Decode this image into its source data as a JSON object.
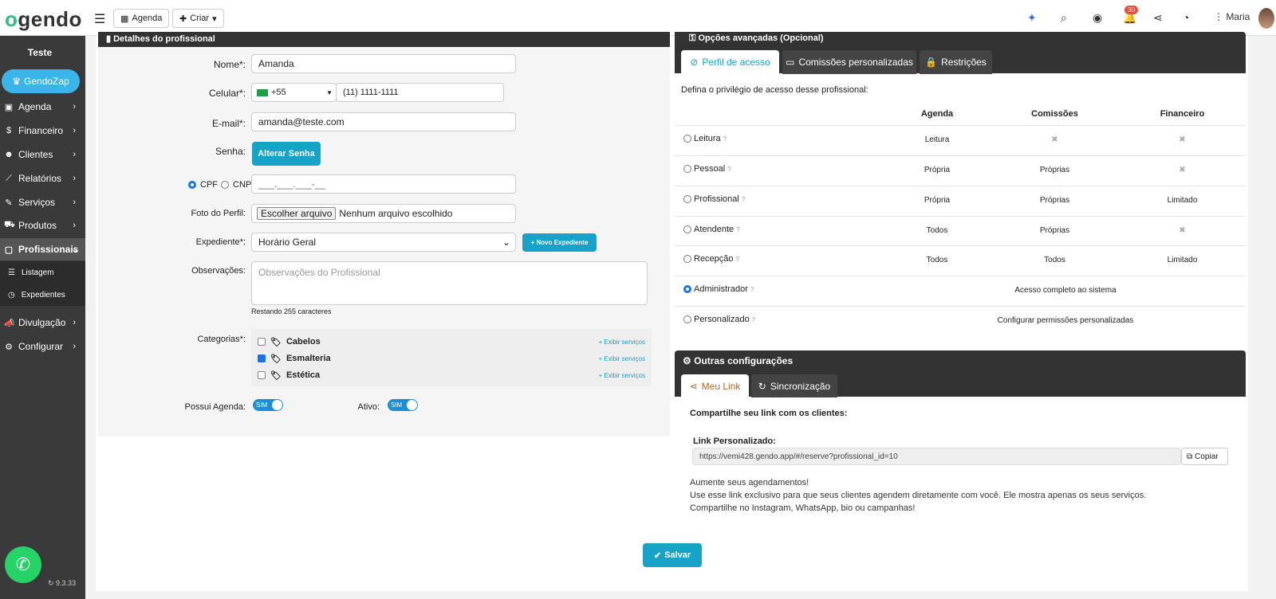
{
  "topbar": {
    "logo_prefix": "o",
    "logo_rest": "gendo",
    "agenda": "Agenda",
    "criar": "Criar",
    "notif_count": "30",
    "user": "Maria"
  },
  "sidebar": {
    "title": "Teste",
    "gendozap": "GendoZap",
    "items": [
      "Agenda",
      "Financeiro",
      "Clientes",
      "Relatórios",
      "Serviços",
      "Produtos",
      "Profissionais",
      "Divulgação",
      "Configurar"
    ],
    "sub": [
      "Listagem",
      "Expedientes"
    ],
    "version": "9.3.33"
  },
  "left": {
    "header": "Detalhes do profissional",
    "nome_label": "Nome*:",
    "nome": "Amanda",
    "celular_label": "Celular*:",
    "ddi": "+55",
    "celular": "(11) 1111-1111",
    "email_label": "E-mail*:",
    "email": "amanda@teste.com",
    "senha_label": "Senha:",
    "alterar_senha": "Alterar Senha",
    "cpf": "CPF",
    "cnpj": "CNPJ",
    "cpf_mask": "___.___.___-__",
    "foto_label": "Foto do Perfil:",
    "file_btn": "Escolher arquivo",
    "file_none": "Nenhum arquivo escolhido",
    "expediente_label": "Expediente*:",
    "expediente": "Horário Geral",
    "novo_expediente": "Novo Expediente",
    "obs_label": "Observações:",
    "obs_placeholder": "Observações do Profissional",
    "restando": "Restando 255 caracteres",
    "categorias_label": "Categorias*:",
    "categorias": [
      {
        "name": "Cabelos",
        "checked": false
      },
      {
        "name": "Esmalteria",
        "checked": true
      },
      {
        "name": "Estética",
        "checked": false
      }
    ],
    "exibir": "Exibir serviços",
    "agenda_label": "Possui Agenda:",
    "ativo_label": "Ativo:",
    "sim": "SIM"
  },
  "right": {
    "header": "Opções avançadas (Opcional)",
    "tabs": [
      "Perfil de acesso",
      "Comissões personalizadas",
      "Restrições"
    ],
    "desc": "Defina o privilégio de acesso desse profissional:",
    "cols": [
      "Agenda",
      "Comissões",
      "Financeiro"
    ],
    "rows": [
      {
        "name": "Leitura",
        "agenda": "Leitura",
        "com": "✖",
        "fin": "✖"
      },
      {
        "name": "Pessoal",
        "agenda": "Própria",
        "com": "Próprias",
        "fin": "✖"
      },
      {
        "name": "Profissional",
        "agenda": "Própria",
        "com": "Próprias",
        "fin": "Limitado"
      },
      {
        "name": "Atendente",
        "agenda": "Todos",
        "com": "Próprias",
        "fin": "✖"
      },
      {
        "name": "Recepção",
        "agenda": "Todos",
        "com": "Todos",
        "fin": "Limitado"
      },
      {
        "name": "Administrador",
        "span": "Acesso completo ao sistema"
      },
      {
        "name": "Personalizado",
        "span": "Configurar permissões personalizadas"
      }
    ],
    "outras": "Outras configurações",
    "tabs2": [
      "Meu Link",
      "Sincronização"
    ],
    "compartilhe": "Compartilhe seu link com os clientes:",
    "link_label": "Link Personalizado:",
    "link": "https://vemi428.gendo.app/#/reserve?profissional_id=10",
    "copiar": "Copiar",
    "p1": "Aumente seus agendamentos!",
    "p2": "Use esse link exclusivo para que seus clientes agendem diretamente com você. Ele mostra apenas os seus serviços.",
    "p3": "Compartilhe no Instagram, WhatsApp, bio ou campanhas!"
  },
  "salvar": "Salvar"
}
